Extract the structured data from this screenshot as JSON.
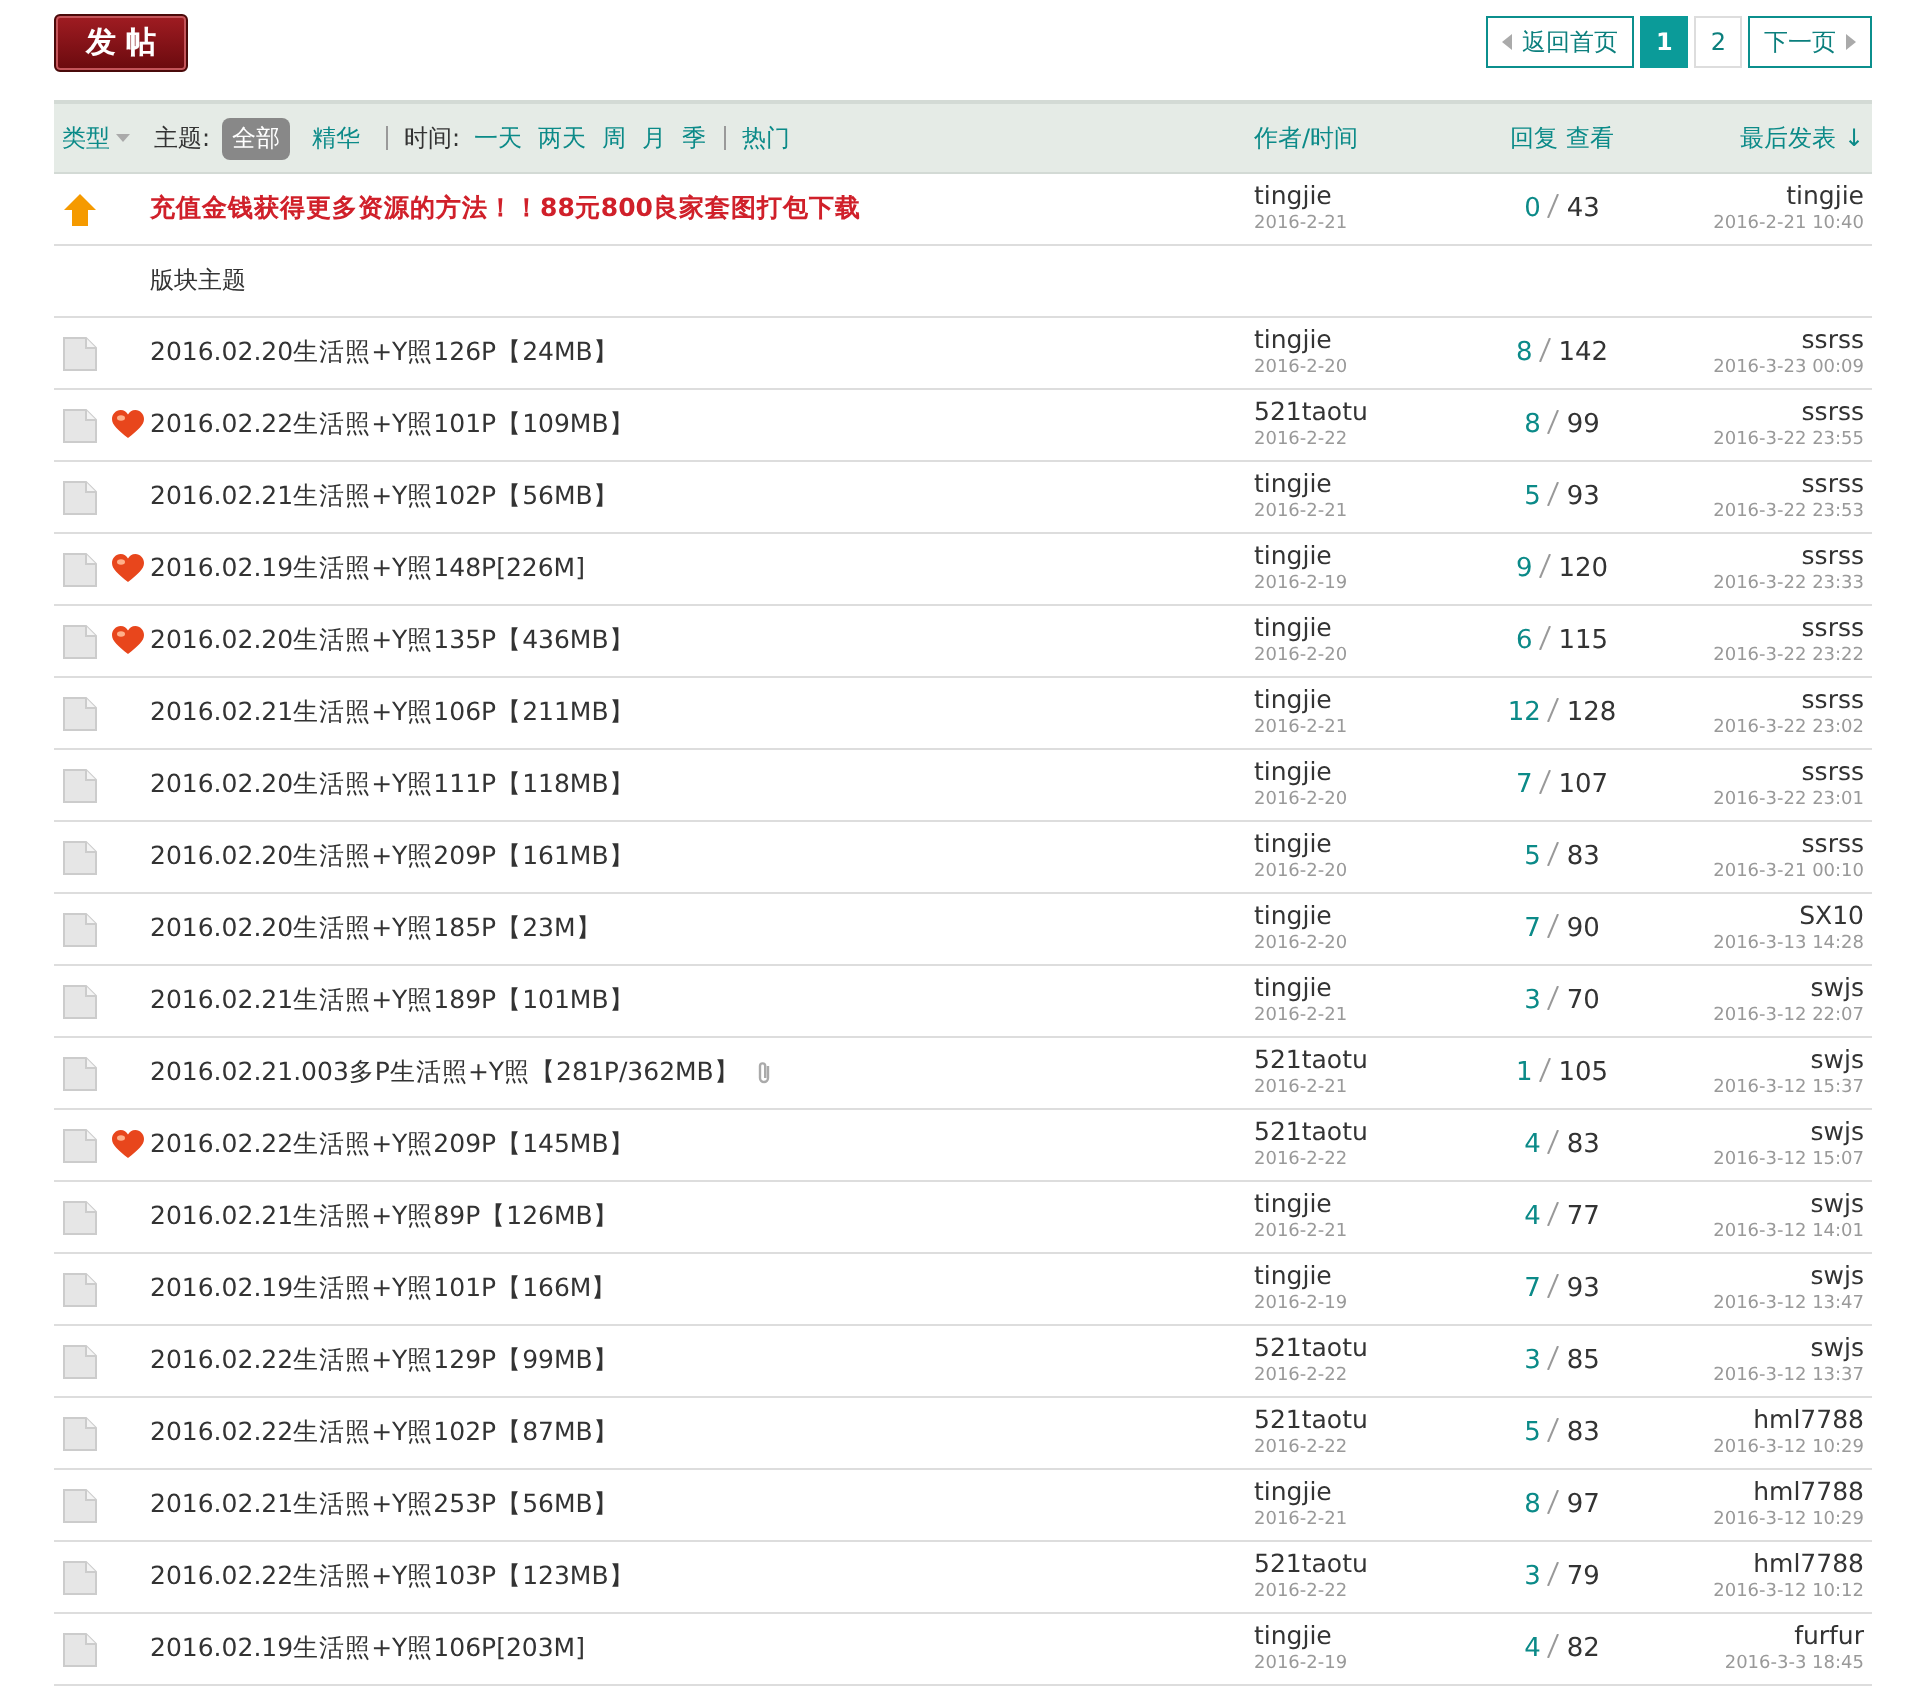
{
  "post_button": "发 帖",
  "pagination": [
    {
      "label": "返回首页",
      "kind": "prev",
      "selected": false
    },
    {
      "label": "1",
      "kind": "page",
      "selected": true
    },
    {
      "label": "2",
      "kind": "page",
      "selected": false
    },
    {
      "label": "下一页",
      "kind": "next",
      "selected": false
    }
  ],
  "filters": {
    "type_label": "类型",
    "topic_label": "主题:",
    "topic_options": [
      {
        "label": "全部",
        "selected": true
      },
      {
        "label": "精华",
        "selected": false
      }
    ],
    "time_label": "时间:",
    "time_options": [
      {
        "label": "一天",
        "selected": false
      },
      {
        "label": "两天",
        "selected": false
      },
      {
        "label": "周",
        "selected": false
      },
      {
        "label": "月",
        "selected": false
      },
      {
        "label": "季",
        "selected": false
      }
    ],
    "hot_label": "热门"
  },
  "columns": {
    "author": "作者/时间",
    "stats": "回复 查看",
    "last": "最后发表",
    "sort_arrow": "↓"
  },
  "sticky": {
    "title": "充值金钱获得更多资源的方法！！88元800良家套图打包下载",
    "author": "tingjie",
    "date": "2016-2-21",
    "replies": "0",
    "views": "43",
    "last_user": "tingjie",
    "last_time": "2016-2-21 10:40"
  },
  "section_label": "版块主题",
  "threads": [
    {
      "title": "2016.02.20生活照+Y照126P【24MB】",
      "hot": false,
      "attachment": false,
      "author": "tingjie",
      "date": "2016-2-20",
      "replies": "8",
      "views": "142",
      "last_user": "ssrss",
      "last_time": "2016-3-23 00:09"
    },
    {
      "title": "2016.02.22生活照+Y照101P【109MB】",
      "hot": true,
      "attachment": false,
      "author": "521taotu",
      "date": "2016-2-22",
      "replies": "8",
      "views": "99",
      "last_user": "ssrss",
      "last_time": "2016-3-22 23:55"
    },
    {
      "title": "2016.02.21生活照+Y照102P【56MB】",
      "hot": false,
      "attachment": false,
      "author": "tingjie",
      "date": "2016-2-21",
      "replies": "5",
      "views": "93",
      "last_user": "ssrss",
      "last_time": "2016-3-22 23:53"
    },
    {
      "title": "2016.02.19生活照+Y照148P[226M]",
      "hot": true,
      "attachment": false,
      "author": "tingjie",
      "date": "2016-2-19",
      "replies": "9",
      "views": "120",
      "last_user": "ssrss",
      "last_time": "2016-3-22 23:33"
    },
    {
      "title": "2016.02.20生活照+Y照135P【436MB】",
      "hot": true,
      "attachment": false,
      "author": "tingjie",
      "date": "2016-2-20",
      "replies": "6",
      "views": "115",
      "last_user": "ssrss",
      "last_time": "2016-3-22 23:22"
    },
    {
      "title": "2016.02.21生活照+Y照106P【211MB】",
      "hot": false,
      "attachment": false,
      "author": "tingjie",
      "date": "2016-2-21",
      "replies": "12",
      "views": "128",
      "last_user": "ssrss",
      "last_time": "2016-3-22 23:02"
    },
    {
      "title": "2016.02.20生活照+Y照111P【118MB】",
      "hot": false,
      "attachment": false,
      "author": "tingjie",
      "date": "2016-2-20",
      "replies": "7",
      "views": "107",
      "last_user": "ssrss",
      "last_time": "2016-3-22 23:01"
    },
    {
      "title": "2016.02.20生活照+Y照209P【161MB】",
      "hot": false,
      "attachment": false,
      "author": "tingjie",
      "date": "2016-2-20",
      "replies": "5",
      "views": "83",
      "last_user": "ssrss",
      "last_time": "2016-3-21 00:10"
    },
    {
      "title": "2016.02.20生活照+Y照185P【23M】",
      "hot": false,
      "attachment": false,
      "author": "tingjie",
      "date": "2016-2-20",
      "replies": "7",
      "views": "90",
      "last_user": "SX10",
      "last_time": "2016-3-13 14:28"
    },
    {
      "title": "2016.02.21生活照+Y照189P【101MB】",
      "hot": false,
      "attachment": false,
      "author": "tingjie",
      "date": "2016-2-21",
      "replies": "3",
      "views": "70",
      "last_user": "swjs",
      "last_time": "2016-3-12 22:07"
    },
    {
      "title": "2016.02.21.003多P生活照+Y照【281P/362MB】",
      "hot": false,
      "attachment": true,
      "author": "521taotu",
      "date": "2016-2-21",
      "replies": "1",
      "views": "105",
      "last_user": "swjs",
      "last_time": "2016-3-12 15:37"
    },
    {
      "title": "2016.02.22生活照+Y照209P【145MB】",
      "hot": true,
      "attachment": false,
      "author": "521taotu",
      "date": "2016-2-22",
      "replies": "4",
      "views": "83",
      "last_user": "swjs",
      "last_time": "2016-3-12 15:07"
    },
    {
      "title": "2016.02.21生活照+Y照89P【126MB】",
      "hot": false,
      "attachment": false,
      "author": "tingjie",
      "date": "2016-2-21",
      "replies": "4",
      "views": "77",
      "last_user": "swjs",
      "last_time": "2016-3-12 14:01"
    },
    {
      "title": "2016.02.19生活照+Y照101P【166M】",
      "hot": false,
      "attachment": false,
      "author": "tingjie",
      "date": "2016-2-19",
      "replies": "7",
      "views": "93",
      "last_user": "swjs",
      "last_time": "2016-3-12 13:47"
    },
    {
      "title": "2016.02.22生活照+Y照129P【99MB】",
      "hot": false,
      "attachment": false,
      "author": "521taotu",
      "date": "2016-2-22",
      "replies": "3",
      "views": "85",
      "last_user": "swjs",
      "last_time": "2016-3-12 13:37"
    },
    {
      "title": "2016.02.22生活照+Y照102P【87MB】",
      "hot": false,
      "attachment": false,
      "author": "521taotu",
      "date": "2016-2-22",
      "replies": "5",
      "views": "83",
      "last_user": "hml7788",
      "last_time": "2016-3-12 10:29"
    },
    {
      "title": "2016.02.21生活照+Y照253P【56MB】",
      "hot": false,
      "attachment": false,
      "author": "tingjie",
      "date": "2016-2-21",
      "replies": "8",
      "views": "97",
      "last_user": "hml7788",
      "last_time": "2016-3-12 10:29"
    },
    {
      "title": "2016.02.22生活照+Y照103P【123MB】",
      "hot": false,
      "attachment": false,
      "author": "521taotu",
      "date": "2016-2-22",
      "replies": "3",
      "views": "79",
      "last_user": "hml7788",
      "last_time": "2016-3-12 10:12"
    },
    {
      "title": "2016.02.19生活照+Y照106P[203M]",
      "hot": false,
      "attachment": false,
      "author": "tingjie",
      "date": "2016-2-19",
      "replies": "4",
      "views": "82",
      "last_user": "furfur",
      "last_time": "2016-3-3 18:45"
    }
  ]
}
